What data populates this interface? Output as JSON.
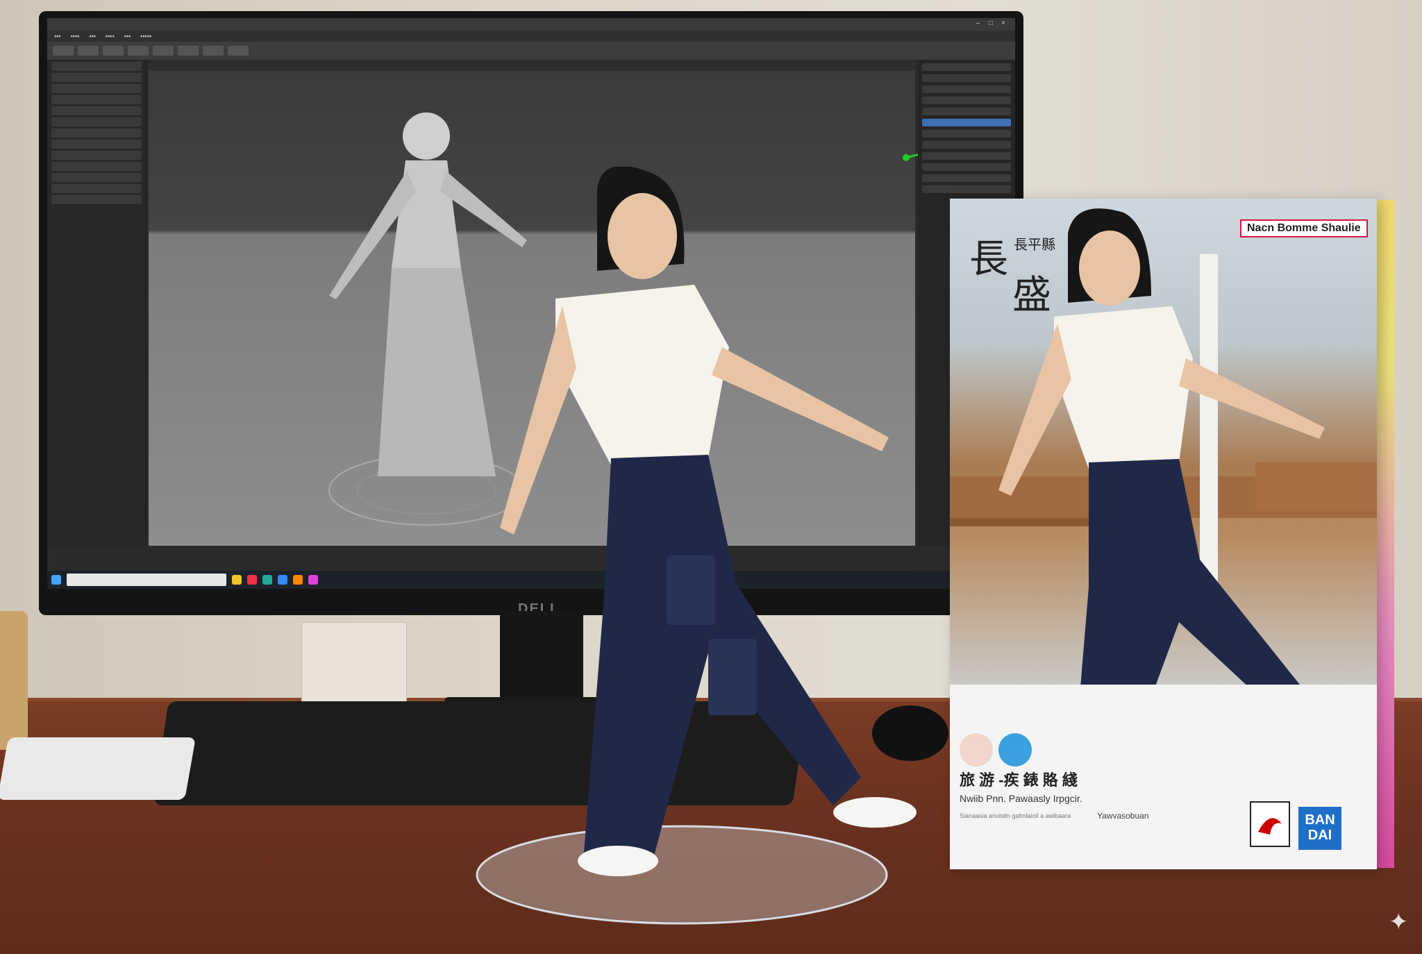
{
  "scene": {
    "monitor_brand": "DELL",
    "box": {
      "name_label": "Nacn Bomme Shaulie",
      "kanji_large_1": "長",
      "kanji_large_2": "盛",
      "kanji_small": "長平縣",
      "title": "旅 游 -疾 錶 賂 綫",
      "subtitle": "Nwiib Pnn. Pawaasly Irpgcir.",
      "subtitle_right": "Yawvasobuan",
      "small_print": "Sianaasia anuisitn gafmlaioil a awibaara",
      "brand_logo": "BAN DAI"
    }
  },
  "icons": [
    "gizmo-icon",
    "sparkle-icon",
    "bandai-logo-icon",
    "bird-logo-icon",
    "windows-start-icon"
  ],
  "colors": {
    "accent_blue": "#3f6fb4",
    "box_pink": "#d94aa0",
    "box_yellow": "#f1d86c",
    "bandai_blue": "#1f6fc9"
  }
}
